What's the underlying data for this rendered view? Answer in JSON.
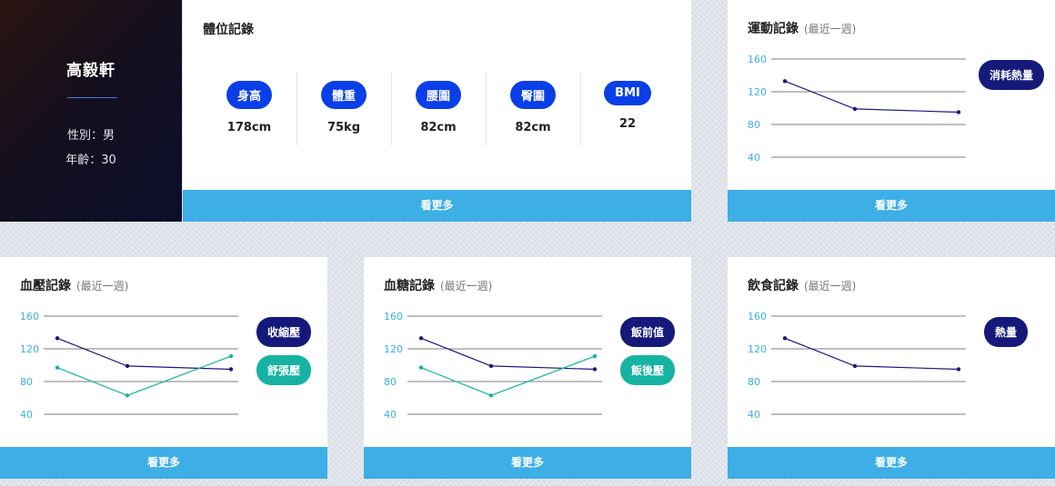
{
  "profile": {
    "name": "高毅軒",
    "gender": "性別：男",
    "age": "年齡：30"
  },
  "body_record": {
    "title": "體位記錄",
    "metrics": [
      {
        "label": "身高",
        "value": "178cm"
      },
      {
        "label": "體重",
        "value": "75kg"
      },
      {
        "label": "腰圍",
        "value": "82cm"
      },
      {
        "label": "臀圍",
        "value": "82cm"
      },
      {
        "label": "BMI",
        "value": "22"
      }
    ],
    "more": "看更多"
  },
  "colors": {
    "navy": "#151a7a",
    "teal": "#17b3a2",
    "more_bar": "#3daee6",
    "pill_blue": "#0a3fe8",
    "tick_blue": "#3daee6"
  },
  "exercise": {
    "title": "運動記錄",
    "subtitle": "(最近一週)",
    "legend": [
      "消耗熱量"
    ],
    "more": "看更多"
  },
  "blood_pressure": {
    "title": "血壓記錄",
    "subtitle": "(最近一週)",
    "legend": [
      "收縮壓",
      "舒張壓"
    ],
    "more": "看更多"
  },
  "blood_sugar": {
    "title": "血糖記錄",
    "subtitle": "(最近一週)",
    "legend": [
      "飯前值",
      "飯後壓"
    ],
    "more": "看更多"
  },
  "diet": {
    "title": "飲食記錄",
    "subtitle": "(最近一週)",
    "legend": [
      "熱量"
    ],
    "more": "看更多"
  },
  "chart_data": [
    {
      "id": "exercise",
      "type": "line",
      "yticks": [
        40,
        80,
        120,
        160
      ],
      "ylim": [
        40,
        160
      ],
      "x": [
        1,
        2,
        3
      ],
      "series": [
        {
          "name": "消耗熱量",
          "values": [
            133,
            99,
            95
          ]
        }
      ]
    },
    {
      "id": "blood_pressure",
      "type": "line",
      "yticks": [
        40,
        80,
        120,
        160
      ],
      "ylim": [
        40,
        160
      ],
      "x": [
        1,
        2,
        3
      ],
      "series": [
        {
          "name": "收縮壓",
          "values": [
            133,
            99,
            95
          ]
        },
        {
          "name": "舒張壓",
          "values": [
            97,
            63,
            111
          ]
        }
      ]
    },
    {
      "id": "blood_sugar",
      "type": "line",
      "yticks": [
        40,
        80,
        120,
        160
      ],
      "ylim": [
        40,
        160
      ],
      "x": [
        1,
        2,
        3
      ],
      "series": [
        {
          "name": "飯前值",
          "values": [
            133,
            99,
            95
          ]
        },
        {
          "name": "飯後壓",
          "values": [
            97,
            63,
            111
          ]
        }
      ]
    },
    {
      "id": "diet",
      "type": "line",
      "yticks": [
        40,
        80,
        120,
        160
      ],
      "ylim": [
        40,
        160
      ],
      "x": [
        1,
        2,
        3
      ],
      "series": [
        {
          "name": "熱量",
          "values": [
            133,
            99,
            95
          ]
        }
      ]
    }
  ]
}
